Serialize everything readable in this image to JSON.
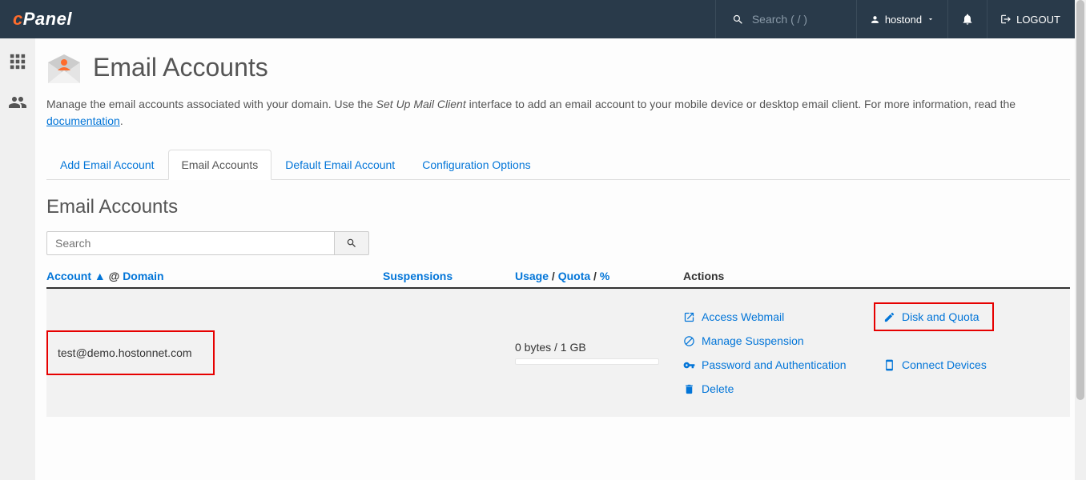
{
  "topbar": {
    "logo_prefix": "c",
    "logo_text": "Panel",
    "search_placeholder": "Search ( / )",
    "user": "hostond",
    "logout": "LOGOUT"
  },
  "page": {
    "title": "Email Accounts",
    "desc_pre": "Manage the email accounts associated with your domain. Use the ",
    "desc_italic": "Set Up Mail Client",
    "desc_mid": " interface to add an email account to your mobile device or desktop email client. For more information, read the ",
    "doc_link": "documentation",
    "desc_end": "."
  },
  "tabs": [
    {
      "label": "Add Email Account"
    },
    {
      "label": "Email Accounts"
    },
    {
      "label": "Default Email Account"
    },
    {
      "label": "Configuration Options"
    }
  ],
  "section": {
    "title": "Email Accounts",
    "search_placeholder": "Search"
  },
  "columns": {
    "account": "Account",
    "sort": "▲",
    "at": "@",
    "domain": "Domain",
    "suspensions": "Suspensions",
    "usage": "Usage",
    "slash1": " / ",
    "quota": "Quota",
    "slash2": " / ",
    "percent": "%",
    "actions": "Actions"
  },
  "row": {
    "email": "test@demo.hostonnet.com",
    "usage": "0 bytes / 1 GB",
    "actions": {
      "webmail": "Access Webmail",
      "disk": "Disk and Quota",
      "suspension": "Manage Suspension",
      "password": "Password and Authentication",
      "connect": "Connect Devices",
      "delete": "Delete"
    }
  }
}
